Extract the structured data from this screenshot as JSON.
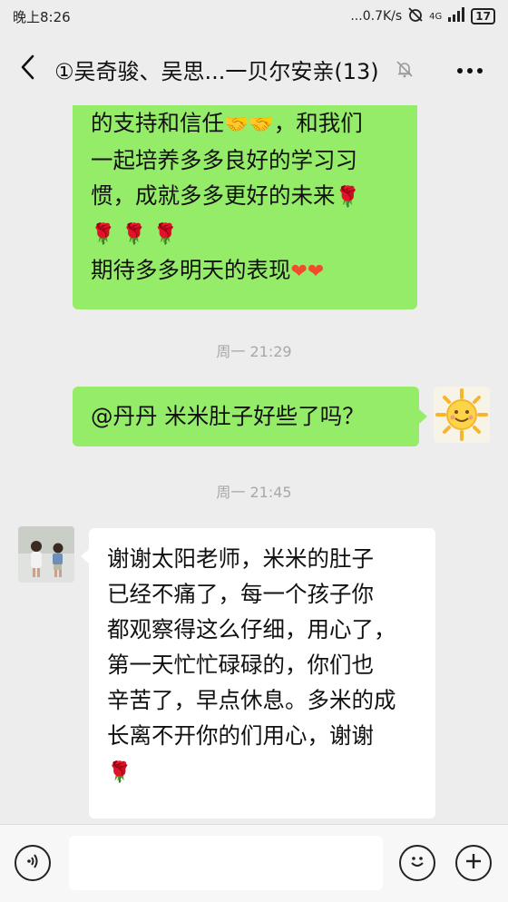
{
  "status_bar": {
    "time": "晚上8:26",
    "net_speed": "...0.7K/s",
    "network": "4G",
    "battery": "17"
  },
  "header": {
    "title": "①吴奇骏、吴思...一贝尔安亲(13)"
  },
  "messages": {
    "msg1": {
      "line1_text": "的支持和信任",
      "line1_end": "，和我们",
      "line2": "一起培养多多良好的学习习",
      "line3": "惯，成就多多更好的未来",
      "line5": "期待多多明天的表现"
    },
    "time1": "周一 21:29",
    "msg2": "@丹丹  米米肚子好些了吗？",
    "time2": "周一 21:45",
    "msg3": {
      "line1": "谢谢太阳老师，米米的肚子",
      "line2": "已经不痛了，每一个孩子你",
      "line3": "都观察得这么仔细，用心了，",
      "line4": "第一天忙忙碌碌的，你们也",
      "line5": "辛苦了，早点休息。多米的成",
      "line6": "长离不开你的们用心，谢谢"
    }
  },
  "colors": {
    "outgoing": "#95ec69",
    "incoming": "#ffffff",
    "background": "#ededed"
  },
  "icons": {
    "back": "chevron-left-icon",
    "mute": "bell-off-icon",
    "more": "more-dots-icon",
    "voice": "voice-icon",
    "emoji": "emoji-icon",
    "plus": "plus-icon"
  }
}
